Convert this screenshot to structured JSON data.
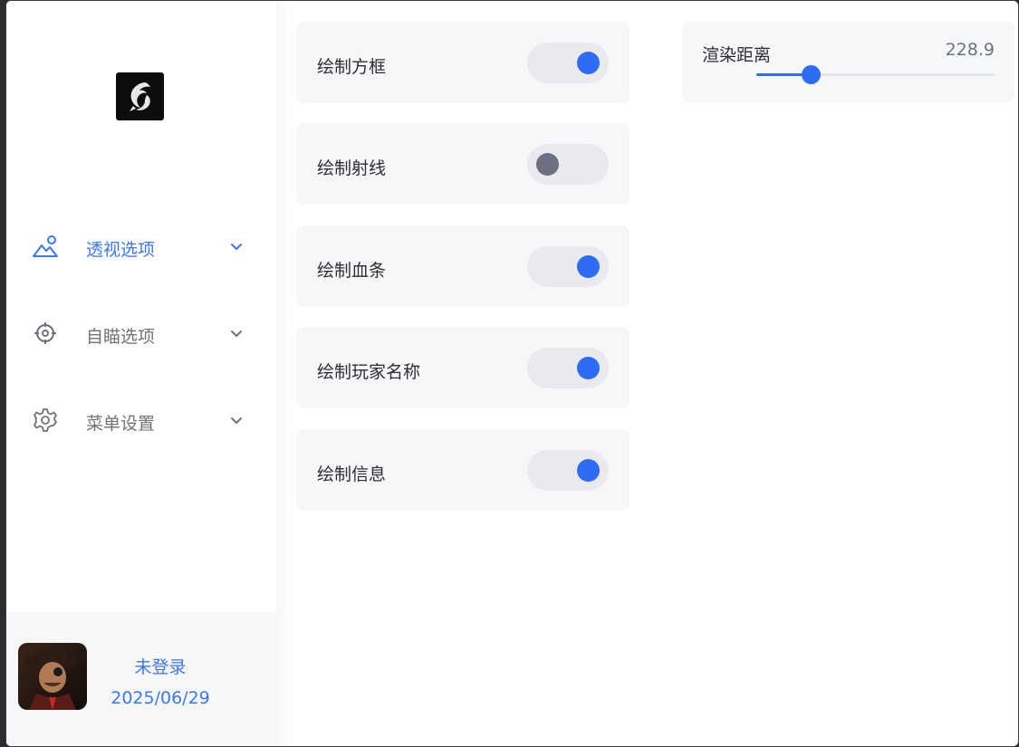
{
  "sidebar": {
    "nav": [
      {
        "label": "透视选项",
        "icon": "landscape-icon",
        "active": true
      },
      {
        "label": "自瞄选项",
        "icon": "crosshair-icon",
        "active": false
      },
      {
        "label": "菜单设置",
        "icon": "gear-icon",
        "active": false
      }
    ],
    "user": {
      "status": "未登录",
      "date": "2025/06/29"
    }
  },
  "options": [
    {
      "label": "绘制方框",
      "enabled": true
    },
    {
      "label": "绘制射线",
      "enabled": false
    },
    {
      "label": "绘制血条",
      "enabled": true
    },
    {
      "label": "绘制玩家名称",
      "enabled": true
    },
    {
      "label": "绘制信息",
      "enabled": true
    }
  ],
  "render_distance": {
    "label": "渲染距离",
    "value": "228.9",
    "fraction": 0.23
  },
  "colors": {
    "accent": "#2f6cf5",
    "card_bg": "#f6f7f9",
    "switch_off_knob": "#6d7080"
  }
}
